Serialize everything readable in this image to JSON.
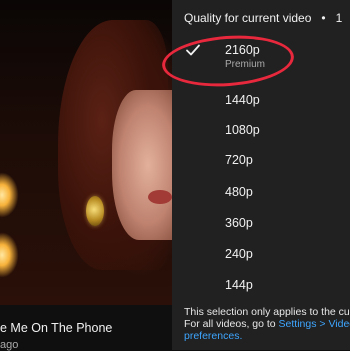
{
  "video": {
    "title": "e Me On The Phone",
    "meta": "ago"
  },
  "quality_panel": {
    "header": "Quality for current video",
    "header_dot": "•",
    "header_tail": "1",
    "selected": "2160p",
    "options": [
      {
        "label": "2160p",
        "sublabel": "Premium",
        "selected": true
      },
      {
        "label": "1440p"
      },
      {
        "label": "1080p"
      },
      {
        "label": "720p"
      },
      {
        "label": "480p"
      },
      {
        "label": "360p"
      },
      {
        "label": "240p"
      },
      {
        "label": "144p"
      }
    ],
    "footer": {
      "line1": "This selection only applies to the curr",
      "line2_prefix": "For all videos, go to ",
      "line2_link": "Settings > Video",
      "line3_link": "preferences."
    }
  },
  "colors": {
    "panel_bg": "#212121",
    "highlight_circle": "#e8283c",
    "link": "#3ea6ff"
  },
  "icons": {
    "selected_marker": "checkmark-icon"
  }
}
